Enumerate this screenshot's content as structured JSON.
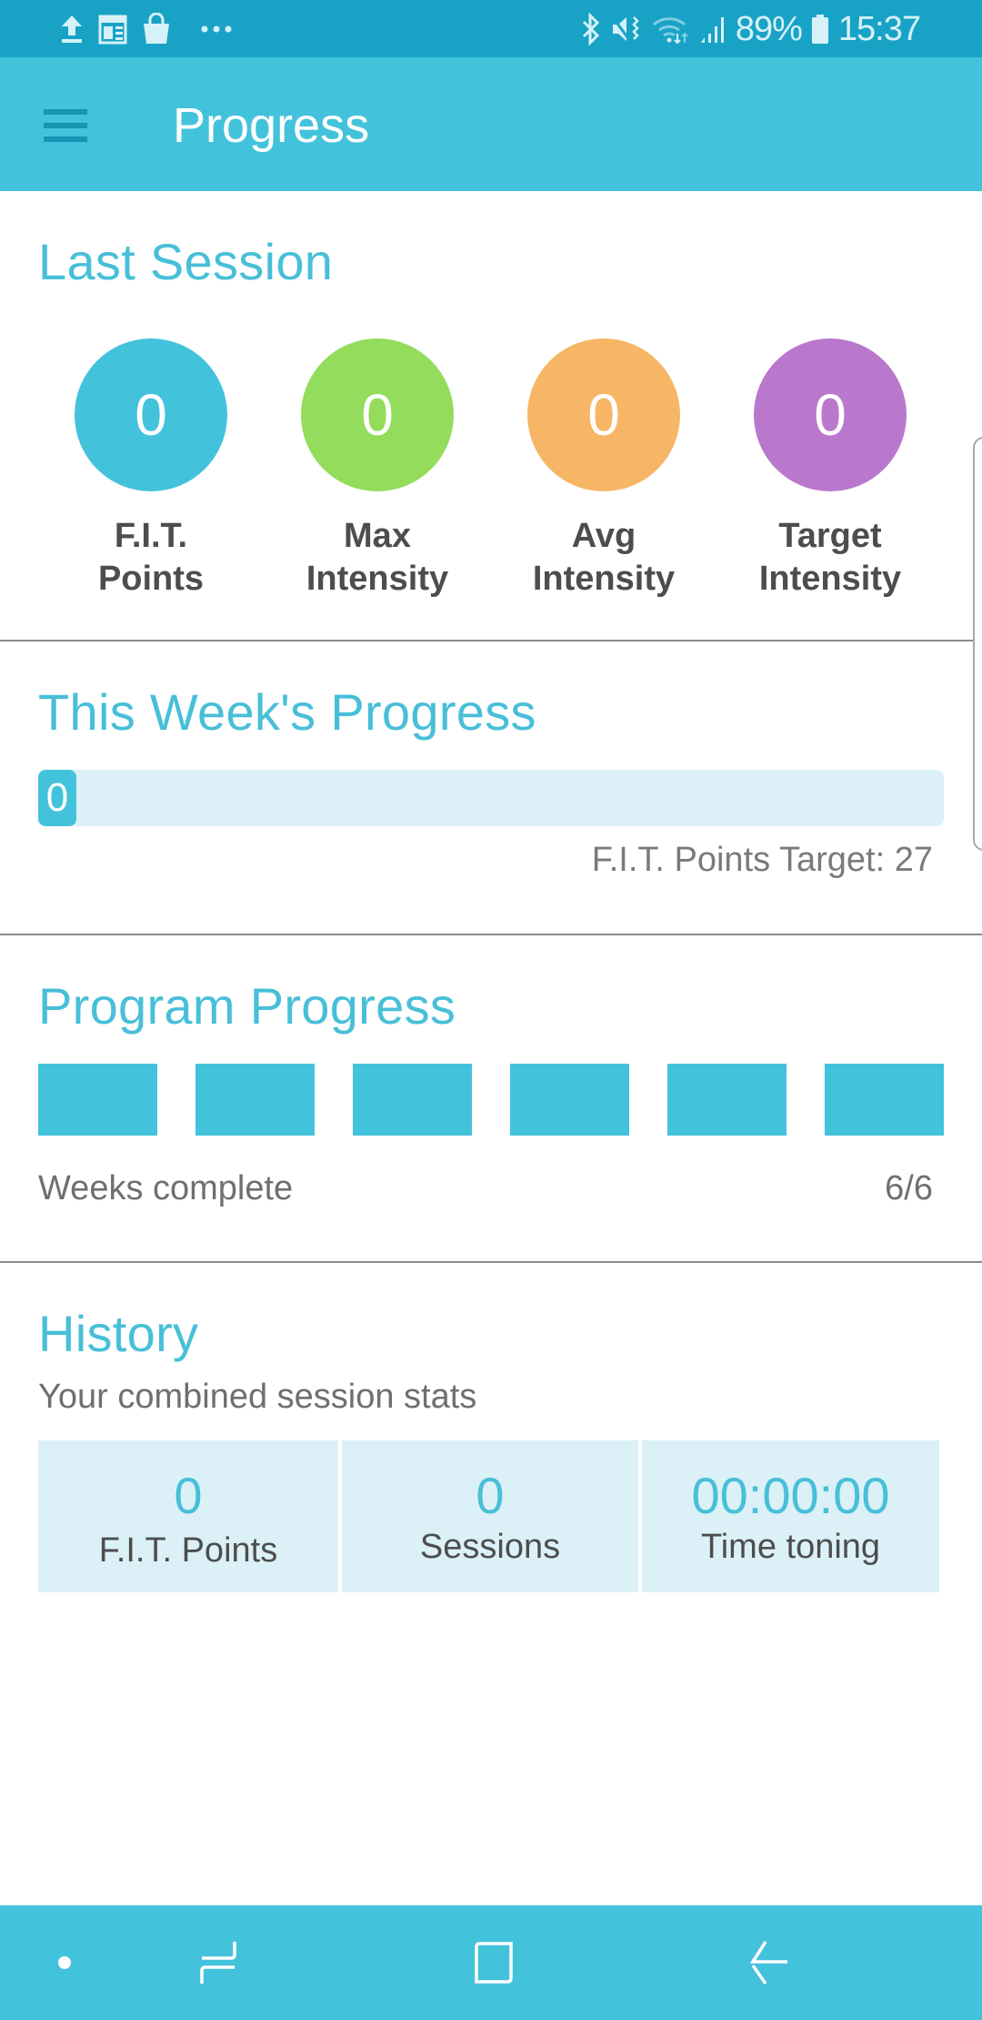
{
  "status_bar": {
    "left_icons": [
      "upload-icon",
      "news-icon",
      "shopping-bag-icon",
      "more-notifications-icon"
    ],
    "right_icons": [
      "bluetooth-icon",
      "mute-vibrate-icon",
      "wifi-icon",
      "signal-icon"
    ],
    "battery": "89%",
    "time": "15:37"
  },
  "app_bar": {
    "menu_icon": "hamburger-menu-icon",
    "title": "Progress"
  },
  "last_session": {
    "title": "Last Session",
    "metrics": [
      {
        "value": "0",
        "label_line1": "F.I.T.",
        "label_line2": "Points",
        "color": "#43c2dc"
      },
      {
        "value": "0",
        "label_line1": "Max",
        "label_line2": "Intensity",
        "color": "#93dc5c"
      },
      {
        "value": "0",
        "label_line1": "Avg",
        "label_line2": "Intensity",
        "color": "#f6b666"
      },
      {
        "value": "0",
        "label_line1": "Target",
        "label_line2": "Intensity",
        "color": "#b978cc"
      }
    ]
  },
  "week_progress": {
    "title": "This Week's Progress",
    "current_points": "0",
    "target_points": 27,
    "target_text": "F.I.T. Points Target: 27"
  },
  "program_progress": {
    "title": "Program Progress",
    "weeks_total": 6,
    "weeks_completed": 6,
    "label": "Weeks complete",
    "value_text": "6/6"
  },
  "history": {
    "title": "History",
    "subtitle": "Your combined session stats",
    "stats": [
      {
        "value": "0",
        "label": "F.I.T. Points"
      },
      {
        "value": "0",
        "label": "Sessions"
      },
      {
        "value": "00:00:00",
        "label": "Time toning"
      }
    ]
  },
  "nav_bar": {
    "buttons": [
      "hide-navbar-dot",
      "recent-apps",
      "home",
      "back"
    ]
  },
  "colors": {
    "accent": "#43c2dc",
    "status_bar": "#18a3c6",
    "light_fill": "#dbf1f7"
  }
}
